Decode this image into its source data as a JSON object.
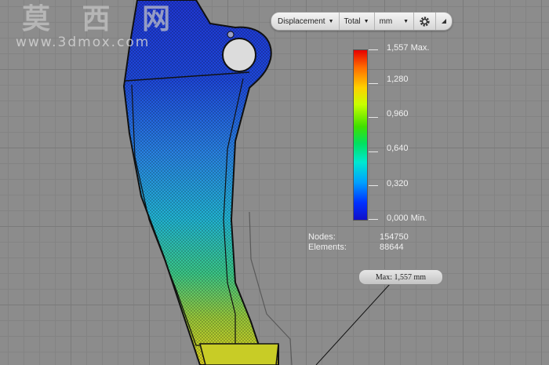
{
  "watermark": {
    "text": "莫 西 网",
    "url": "www.3dmox.com"
  },
  "toolbar": {
    "display": "Displacement",
    "component": "Total",
    "units": "mm"
  },
  "legend": {
    "max": "1,557 Max.",
    "v1": "1,280",
    "v2": "0,960",
    "v3": "0,640",
    "v4": "0,320",
    "min": "0,000 Min."
  },
  "stats": {
    "nodes_label": "Nodes:",
    "nodes_value": "154750",
    "elements_label": "Elements:",
    "elements_value": "88644"
  },
  "probe": {
    "label": "Max: 1,557 mm"
  },
  "colors": {
    "accent_max": "#e60000",
    "accent_min": "#1010c8",
    "background": "#8c8c8c"
  }
}
